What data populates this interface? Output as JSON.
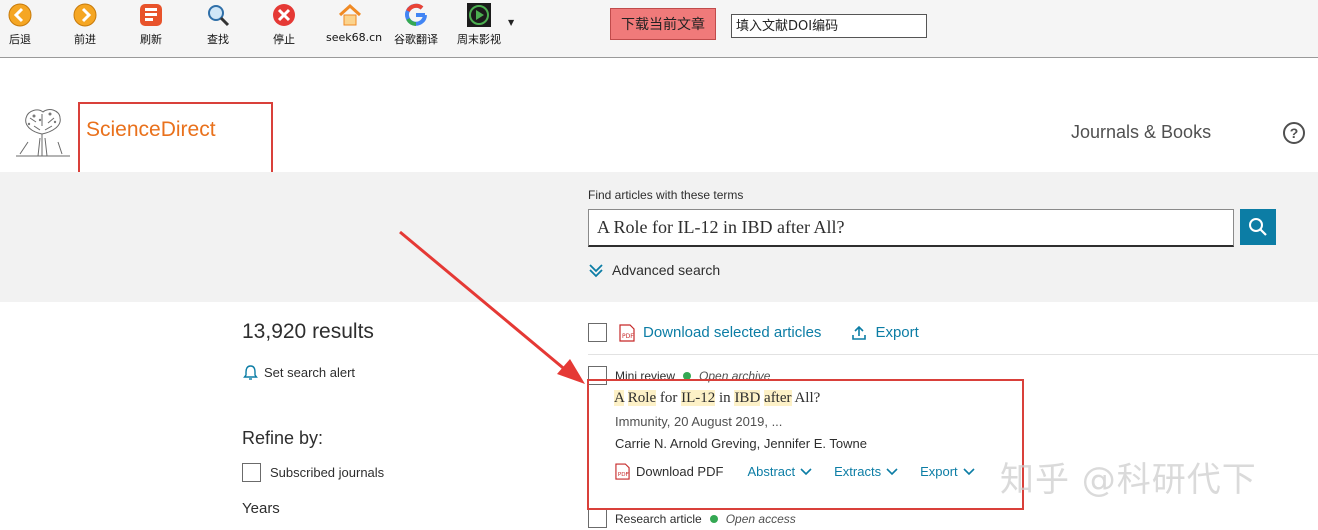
{
  "toolbar": {
    "buttons": [
      {
        "label": "后退",
        "icon": "back-icon"
      },
      {
        "label": "前进",
        "icon": "forward-icon"
      },
      {
        "label": "刷新",
        "icon": "refresh-icon"
      },
      {
        "label": "查找",
        "icon": "find-icon"
      },
      {
        "label": "停止",
        "icon": "stop-icon"
      },
      {
        "label": "seek68.cn",
        "icon": "home-icon"
      },
      {
        "label": "谷歌翻译",
        "icon": "google-icon"
      },
      {
        "label": "周末影视",
        "icon": "play-icon"
      }
    ],
    "download_button": "下载当前文章",
    "doi_placeholder": "填入文献DOI编码"
  },
  "header": {
    "brand": "ScienceDirect",
    "journals_books": "Journals & Books",
    "help": "?"
  },
  "search": {
    "label": "Find articles with these terms",
    "query": "A Role for IL-12 in IBD after All?",
    "advanced": "Advanced search"
  },
  "sidebar": {
    "results_count": "13,920 results",
    "set_alert": "Set search alert",
    "refine_by": "Refine by:",
    "subscribed_journals": "Subscribed journals",
    "years": "Years"
  },
  "bulk_actions": {
    "download_selected": "Download selected articles",
    "export": "Export"
  },
  "results": [
    {
      "type": "Mini review",
      "access": "Open archive",
      "title_parts": [
        {
          "text": "A",
          "hl": true
        },
        {
          "text": " ",
          "hl": false
        },
        {
          "text": "Role",
          "hl": true
        },
        {
          "text": " for ",
          "hl": false
        },
        {
          "text": "IL-12",
          "hl": true
        },
        {
          "text": " in ",
          "hl": false
        },
        {
          "text": "IBD",
          "hl": true
        },
        {
          "text": " ",
          "hl": false
        },
        {
          "text": "after",
          "hl": true
        },
        {
          "text": " All?",
          "hl": false
        }
      ],
      "source": "Immunity, 20 August 2019, ...",
      "authors": "Carrie N. Arnold Greving, Jennifer E. Towne",
      "actions": {
        "pdf": "Download PDF",
        "abstract": "Abstract",
        "extracts": "Extracts",
        "export": "Export"
      }
    },
    {
      "type": "Research article",
      "access": "Open access"
    }
  ],
  "watermark": "知乎 @科研代下",
  "colors": {
    "brand_orange": "#e9711c",
    "link_blue": "#0c7da5",
    "annotation_red": "#d9403a",
    "highlight": "#fdf1c7",
    "open_green": "#34a853"
  }
}
